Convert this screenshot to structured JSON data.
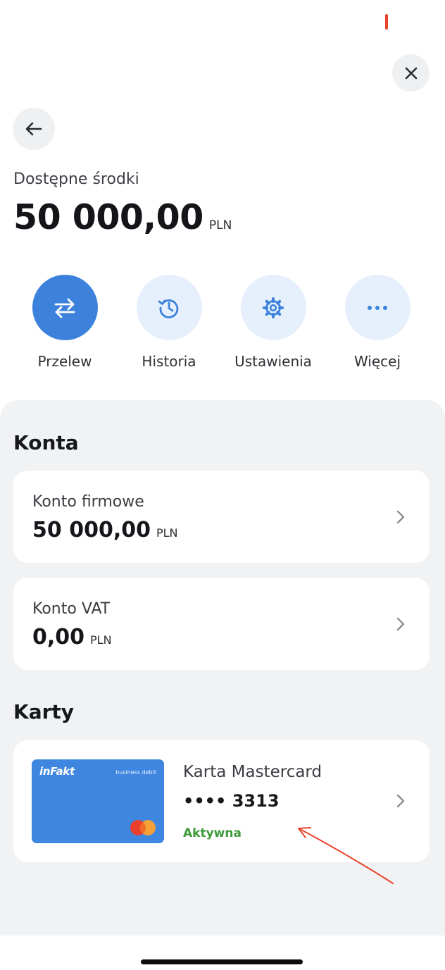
{
  "header": {
    "close_icon": "close-icon",
    "back_icon": "arrow-left-icon"
  },
  "balance": {
    "label": "Dostępne środki",
    "amount": "50 000,00",
    "currency": "PLN"
  },
  "actions": [
    {
      "label": "Przelew",
      "icon": "transfer-arrows-icon"
    },
    {
      "label": "Historia",
      "icon": "history-icon"
    },
    {
      "label": "Ustawienia",
      "icon": "gear-icon"
    },
    {
      "label": "Więcej",
      "icon": "more-dots-icon"
    }
  ],
  "accounts": {
    "title": "Konta",
    "items": [
      {
        "name": "Konto firmowe",
        "amount": "50 000,00",
        "currency": "PLN"
      },
      {
        "name": "Konto VAT",
        "amount": "0,00",
        "currency": "PLN"
      }
    ]
  },
  "cards": {
    "title": "Karty",
    "items": [
      {
        "brand_logo": "inFakt",
        "card_type": "business  debit",
        "name": "Karta Mastercard",
        "number": "•••• 3313",
        "status": "Aktywna"
      }
    ]
  },
  "colors": {
    "accent": "#3c82dc",
    "action_bg": "#e6f0fc",
    "panel_bg": "#f1f2f4",
    "status_active": "#3d9a3a",
    "annotation_arrow": "#e8442a"
  }
}
